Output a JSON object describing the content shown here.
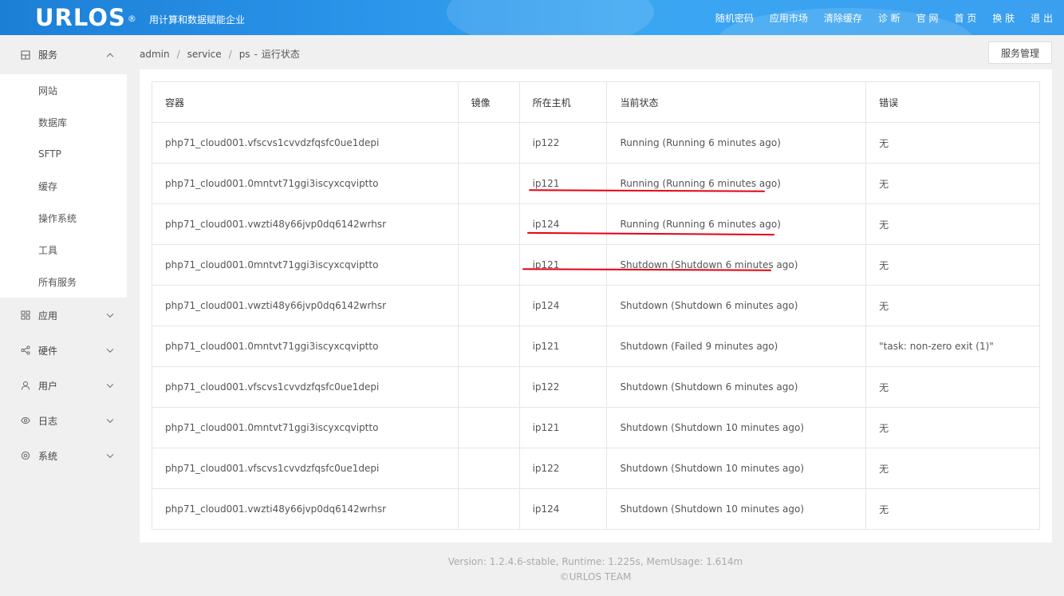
{
  "header": {
    "logo": "URLOS",
    "logo_mark": "®",
    "slogan": "用计算和数据赋能企业",
    "nav": [
      "随机密码",
      "应用市场",
      "清除缓存",
      "诊 断",
      "官 网",
      "首 页",
      "换 肤",
      "退 出"
    ]
  },
  "sidebar": {
    "services": {
      "label": "服务",
      "icon": "grid-icon"
    },
    "service_items": [
      "网站",
      "数据库",
      "SFTP",
      "缓存",
      "操作系统",
      "工具",
      "所有服务"
    ],
    "groups": [
      {
        "label": "应用",
        "icon": "apps-icon"
      },
      {
        "label": "硬件",
        "icon": "share-icon"
      },
      {
        "label": "用户",
        "icon": "user-icon"
      },
      {
        "label": "日志",
        "icon": "eye-icon"
      },
      {
        "label": "系统",
        "icon": "gear-icon"
      }
    ]
  },
  "breadcrumb": {
    "p1": "admin",
    "p2": "service",
    "p3": "ps",
    "p4": "运行状态"
  },
  "service_manage_button": "服务管理",
  "table": {
    "headers": [
      "容器",
      "镜像",
      "所在主机",
      "当前状态",
      "错误"
    ],
    "rows": [
      [
        "php71_cloud001.vfscvs1cvvdzfqsfc0ue1depi",
        "",
        "ip122",
        "Running (Running 6 minutes ago)",
        "无"
      ],
      [
        "php71_cloud001.0mntvt71ggi3iscyxcqviptto",
        "",
        "ip121",
        "Running (Running 6 minutes ago)",
        "无"
      ],
      [
        "php71_cloud001.vwzti48y66jvp0dq6142wrhsr",
        "",
        "ip124",
        "Running (Running 6 minutes ago)",
        "无"
      ],
      [
        "php71_cloud001.0mntvt71ggi3iscyxcqviptto",
        "",
        "ip121",
        "Shutdown (Shutdown 6 minutes ago)",
        "无"
      ],
      [
        "php71_cloud001.vwzti48y66jvp0dq6142wrhsr",
        "",
        "ip124",
        "Shutdown (Shutdown 6 minutes ago)",
        "无"
      ],
      [
        "php71_cloud001.0mntvt71ggi3iscyxcqviptto",
        "",
        "ip121",
        "Shutdown (Failed 9 minutes ago)",
        "\"task: non-zero exit (1)\""
      ],
      [
        "php71_cloud001.vfscvs1cvvdzfqsfc0ue1depi",
        "",
        "ip122",
        "Shutdown (Shutdown 6 minutes ago)",
        "无"
      ],
      [
        "php71_cloud001.0mntvt71ggi3iscyxcqviptto",
        "",
        "ip121",
        "Shutdown (Shutdown 10 minutes ago)",
        "无"
      ],
      [
        "php71_cloud001.vfscvs1cvvdzfqsfc0ue1depi",
        "",
        "ip122",
        "Shutdown (Shutdown 10 minutes ago)",
        "无"
      ],
      [
        "php71_cloud001.vwzti48y66jvp0dq6142wrhsr",
        "",
        "ip124",
        "Shutdown (Shutdown 10 minutes ago)",
        "无"
      ]
    ]
  },
  "annotation_color": "#e60012",
  "footer": {
    "line1": "Version: 1.2.4.6-stable,   Runtime: 1.225s,   MemUsage: 1.614m",
    "line2": "©URLOS TEAM"
  }
}
